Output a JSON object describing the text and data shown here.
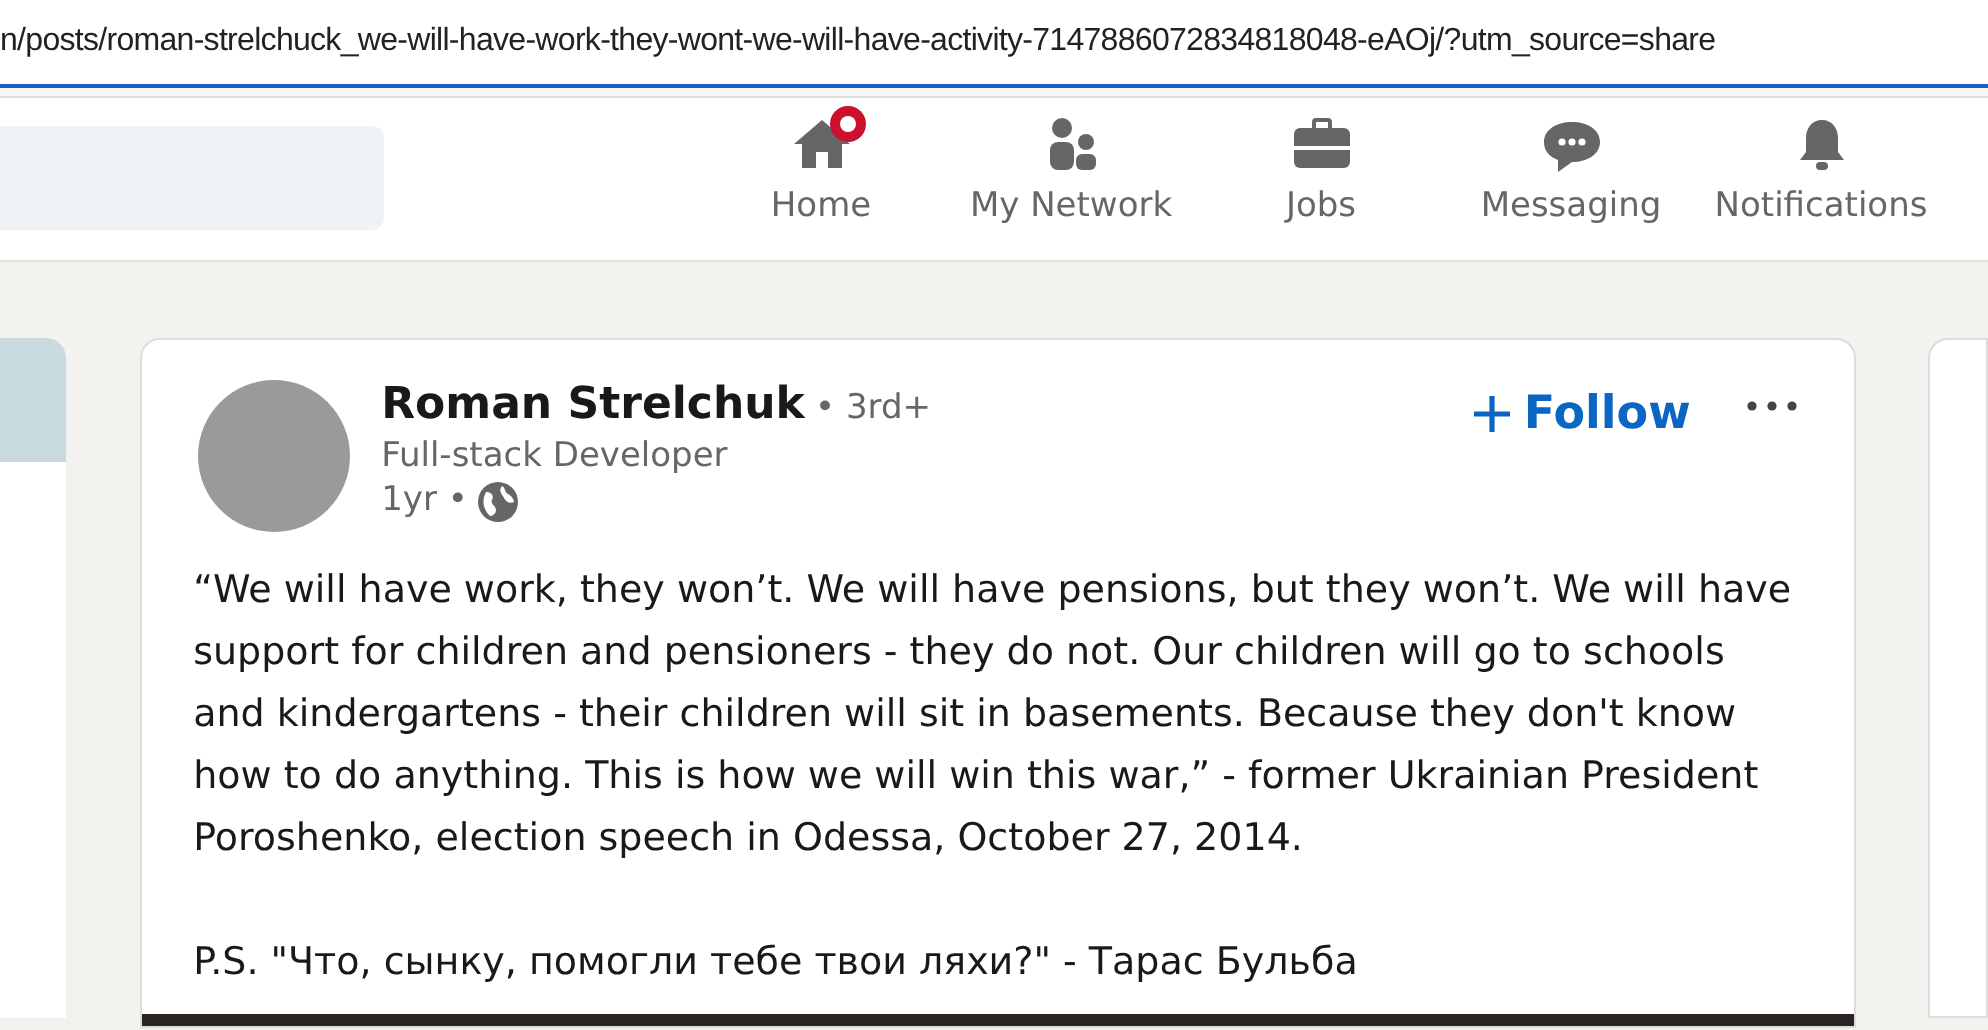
{
  "address_bar": {
    "url": "n/posts/roman-strelchuck_we-will-have-work-they-wont-we-will-have-activity-7147886072834818048-eAOj/?utm_source=share"
  },
  "nav": [
    {
      "kind": "home",
      "label": "Home",
      "notification": true
    },
    {
      "kind": "network",
      "label": "My Network",
      "notification": false
    },
    {
      "kind": "jobs",
      "label": "Jobs",
      "notification": false
    },
    {
      "kind": "messaging",
      "label": "Messaging",
      "notification": false
    },
    {
      "kind": "notifications",
      "label": "Notifications",
      "notification": false
    }
  ],
  "post": {
    "author": "Roman Strelchuk",
    "degree": "• 3rd+",
    "headline": "Full-stack Developer",
    "time": "1yr •",
    "follow": "Follow",
    "paragraphs": [
      "“We will have work, they won’t. We will have pensions, but they won’t. We will have support for children and pensioners - they do not. Our children will go to schools and kindergartens - their children will sit in basements. Because they don't know how to do anything. This is how we will win this war,” - former Ukrainian President Poroshenko, election speech in Odessa, October 27, 2014.",
      "P.S. \"Что, сынку, помогли тебе твои ляхи?\" - Тарас Бульба"
    ]
  }
}
